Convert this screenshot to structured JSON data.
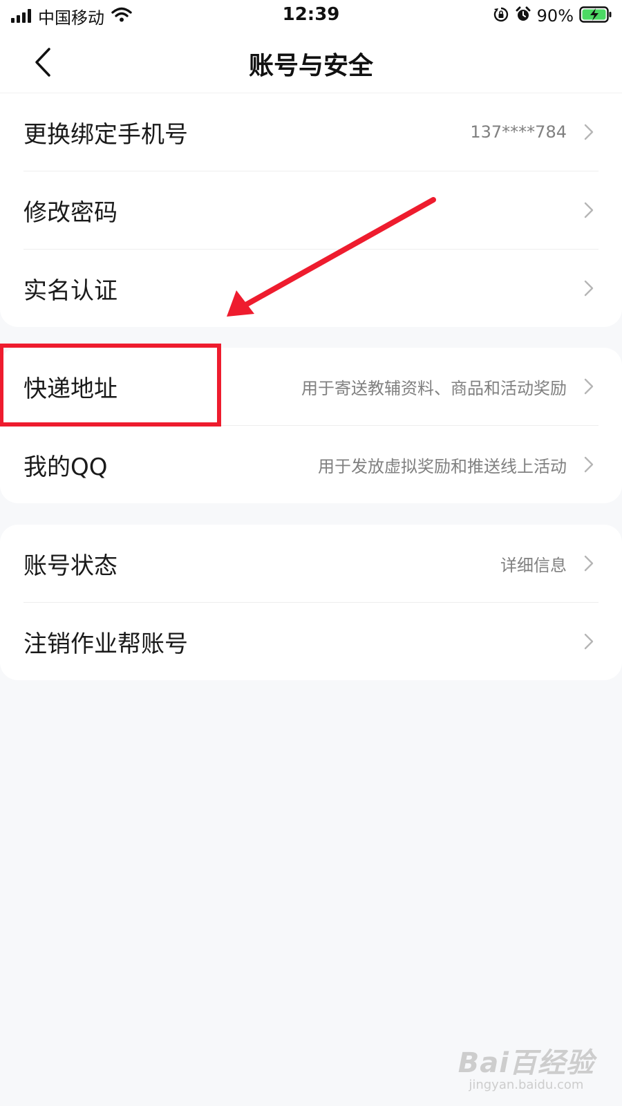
{
  "status_bar": {
    "carrier": "中国移动",
    "time": "12:39",
    "battery_percent": "90%",
    "icons": [
      "signal-icon",
      "wifi-icon",
      "orientation-lock-icon",
      "alarm-icon",
      "battery-charging-icon"
    ]
  },
  "nav": {
    "title": "账号与安全",
    "back_icon": "chevron-left-icon"
  },
  "sections": [
    {
      "rows": [
        {
          "label": "更换绑定手机号",
          "value": "137****784"
        },
        {
          "label": "修改密码",
          "value": ""
        },
        {
          "label": "实名认证",
          "value": ""
        }
      ]
    },
    {
      "rows": [
        {
          "label": "快递地址",
          "value": "用于寄送教辅资料、商品和活动奖励"
        },
        {
          "label": "我的QQ",
          "value": "用于发放虚拟奖励和推送线上活动"
        }
      ]
    },
    {
      "rows": [
        {
          "label": "账号状态",
          "value": "详细信息"
        },
        {
          "label": "注销作业帮账号",
          "value": ""
        }
      ]
    }
  ],
  "watermark": {
    "main": "Bai百经验",
    "sub": "jingyan.baidu.com"
  },
  "colors": {
    "background": "#f7f8fa",
    "card": "#ffffff",
    "annotation_red": "#ee1c2e",
    "battery_green": "#4cd964",
    "secondary_text": "#808080"
  }
}
